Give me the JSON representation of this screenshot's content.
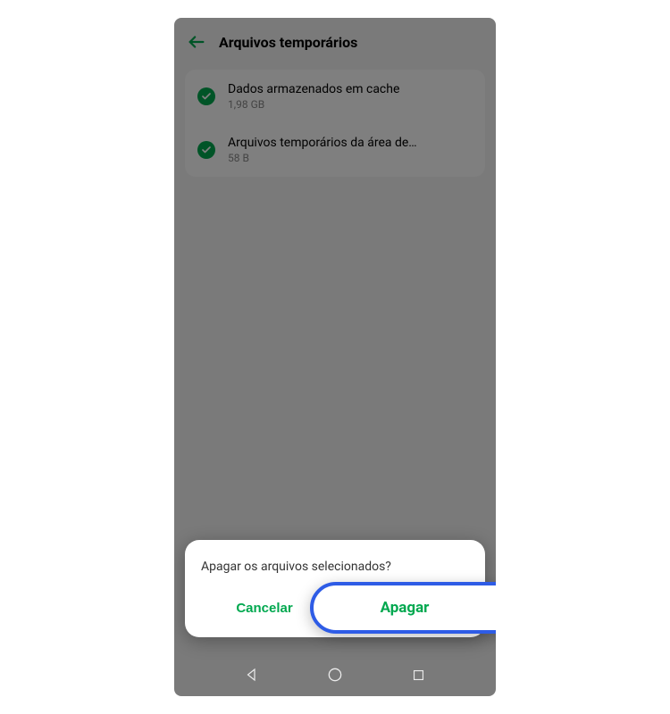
{
  "header": {
    "title": "Arquivos temporários"
  },
  "list": {
    "items": [
      {
        "title": "Dados armazenados em cache",
        "size": "1,98 GB"
      },
      {
        "title": "Arquivos temporários da área de…",
        "size": "58 B"
      }
    ]
  },
  "dialog": {
    "message": "Apagar os arquivos selecionados?",
    "cancel_label": "Cancelar",
    "confirm_label": "Apagar"
  },
  "colors": {
    "accent": "#00a84f",
    "highlight_ring": "#2e5ce6"
  }
}
